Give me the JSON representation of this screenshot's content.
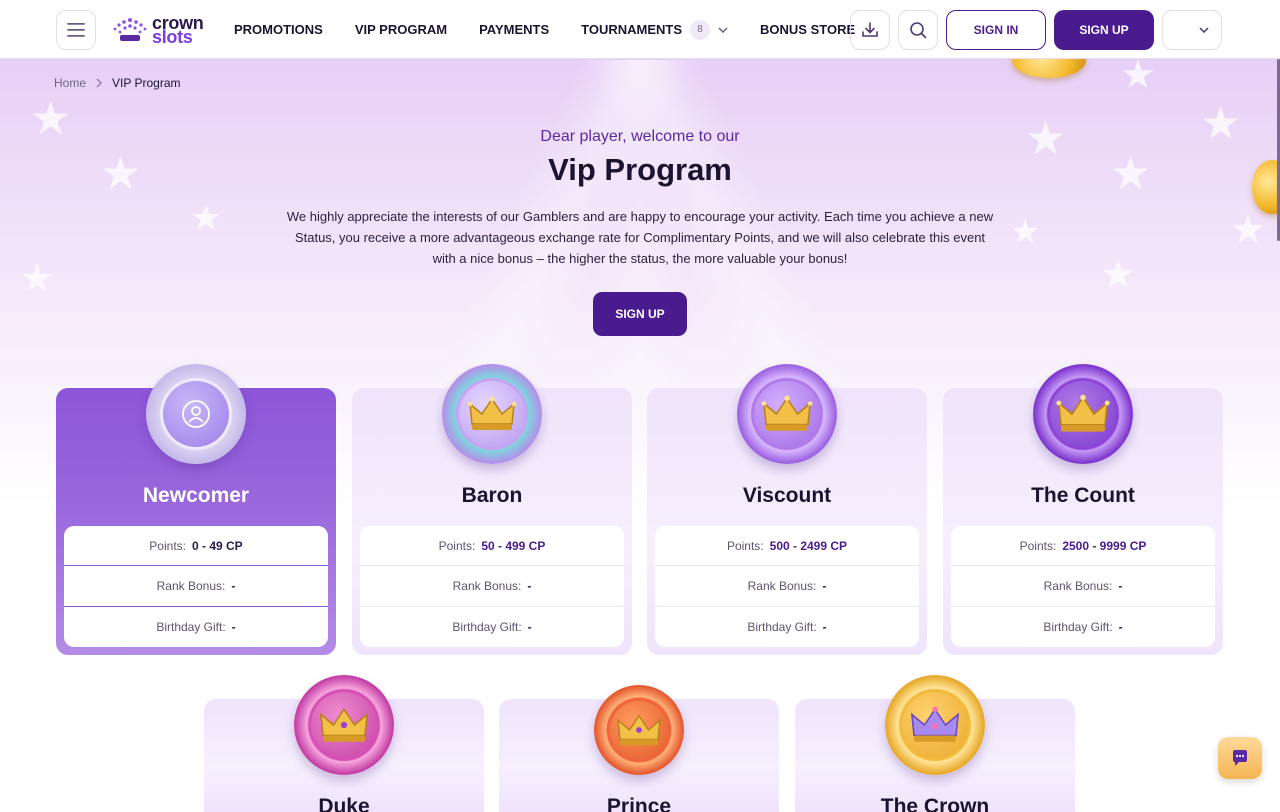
{
  "header": {
    "logo_top": "crown",
    "logo_bottom": "slots",
    "nav": [
      {
        "label": "PROMOTIONS"
      },
      {
        "label": "VIP PROGRAM"
      },
      {
        "label": "PAYMENTS"
      },
      {
        "label": "TOURNAMENTS",
        "badge": "8",
        "has_dropdown": true
      },
      {
        "label": "BONUS STORE"
      }
    ],
    "sign_in": "SIGN IN",
    "sign_up": "SIGN UP",
    "icons": [
      "menu-icon",
      "download-icon",
      "search-icon",
      "chevron-down-icon"
    ]
  },
  "breadcrumb": {
    "home": "Home",
    "current": "VIP Program"
  },
  "hero": {
    "subtitle": "Dear player, welcome to our",
    "title": "Vip Program",
    "description": "We highly appreciate the interests of our Gamblers and are happy to encourage your activity. Each time you achieve a new Status, you receive a more advantageous exchange rate for Complimentary Points, and we will also celebrate this event with a nice bonus – the higher the status, the more valuable your bonus!",
    "button": "SIGN UP"
  },
  "tiers": [
    {
      "name": "Newcomer",
      "points_label": "Points:",
      "points": "0 - 49 CP",
      "rank_label": "Rank Bonus:",
      "rank": "-",
      "gift_label": "Birthday Gift:",
      "gift": "-",
      "active": true,
      "icon": "user-icon"
    },
    {
      "name": "Baron",
      "points_label": "Points:",
      "points": "50 - 499 CP",
      "rank_label": "Rank Bonus:",
      "rank": "-",
      "gift_label": "Birthday Gift:",
      "gift": "-",
      "icon": "crown-icon"
    },
    {
      "name": "Viscount",
      "points_label": "Points:",
      "points": "500 - 2499 CP",
      "rank_label": "Rank Bonus:",
      "rank": "-",
      "gift_label": "Birthday Gift:",
      "gift": "-",
      "icon": "crown-icon"
    },
    {
      "name": "The Count",
      "points_label": "Points:",
      "points": "2500 - 9999 CP",
      "rank_label": "Rank Bonus:",
      "rank": "-",
      "gift_label": "Birthday Gift:",
      "gift": "-",
      "icon": "crown-icon"
    },
    {
      "name": "Duke",
      "icon": "crown-icon"
    },
    {
      "name": "Prince",
      "icon": "crown-icon"
    },
    {
      "name": "The Crown",
      "icon": "crown-icon"
    }
  ],
  "colors": {
    "brand": "#4a1b8e",
    "accent": "#7b3fe0",
    "active_card": "#8c55d8"
  }
}
